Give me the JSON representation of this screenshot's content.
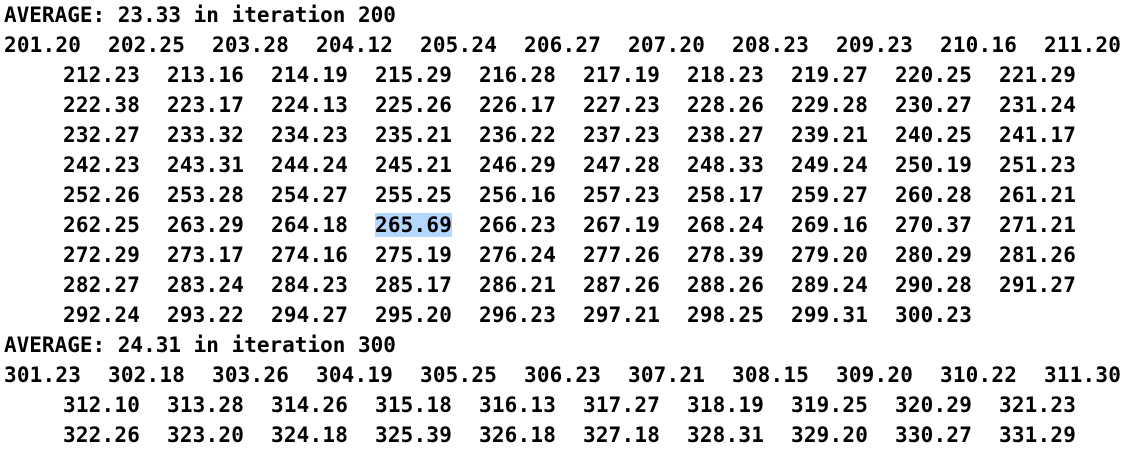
{
  "terminal": {
    "blocks": [
      {
        "average_text": "AVERAGE: 23.33 in iteration 200",
        "rows": [
          [
            "201.20",
            "202.25",
            "203.28",
            "204.12",
            "205.24",
            "206.27",
            "207.20",
            "208.23",
            "209.23",
            "210.16",
            "211.20"
          ],
          [
            "212.23",
            "213.16",
            "214.19",
            "215.29",
            "216.28",
            "217.19",
            "218.23",
            "219.27",
            "220.25",
            "221.29"
          ],
          [
            "222.38",
            "223.17",
            "224.13",
            "225.26",
            "226.17",
            "227.23",
            "228.26",
            "229.28",
            "230.27",
            "231.24"
          ],
          [
            "232.27",
            "233.32",
            "234.23",
            "235.21",
            "236.22",
            "237.23",
            "238.27",
            "239.21",
            "240.25",
            "241.17"
          ],
          [
            "242.23",
            "243.31",
            "244.24",
            "245.21",
            "246.29",
            "247.28",
            "248.33",
            "249.24",
            "250.19",
            "251.23"
          ],
          [
            "252.26",
            "253.28",
            "254.27",
            "255.25",
            "256.16",
            "257.23",
            "258.17",
            "259.27",
            "260.28",
            "261.21"
          ],
          [
            "262.25",
            "263.29",
            "264.18",
            "265.69",
            "266.23",
            "267.19",
            "268.24",
            "269.16",
            "270.37",
            "271.21"
          ],
          [
            "272.29",
            "273.17",
            "274.16",
            "275.19",
            "276.24",
            "277.26",
            "278.39",
            "279.20",
            "280.29",
            "281.26"
          ],
          [
            "282.27",
            "283.24",
            "284.23",
            "285.17",
            "286.21",
            "287.26",
            "288.26",
            "289.24",
            "290.28",
            "291.27"
          ],
          [
            "292.24",
            "293.22",
            "294.27",
            "295.20",
            "296.23",
            "297.21",
            "298.25",
            "299.31",
            "300.23"
          ]
        ]
      },
      {
        "average_text": "AVERAGE: 24.31 in iteration 300",
        "rows": [
          [
            "301.23",
            "302.18",
            "303.26",
            "304.19",
            "305.25",
            "306.23",
            "307.21",
            "308.15",
            "309.20",
            "310.22",
            "311.30"
          ],
          [
            "312.10",
            "313.28",
            "314.26",
            "315.18",
            "316.13",
            "317.27",
            "318.19",
            "319.25",
            "320.29",
            "321.23"
          ],
          [
            "322.26",
            "323.20",
            "324.18",
            "325.39",
            "326.18",
            "327.18",
            "328.31",
            "329.20",
            "330.27",
            "331.29"
          ]
        ]
      }
    ],
    "selection": "265.69",
    "colors": {
      "background": "#ffffff",
      "text": "#000000",
      "selection_highlight": "#b3d7ff"
    }
  }
}
